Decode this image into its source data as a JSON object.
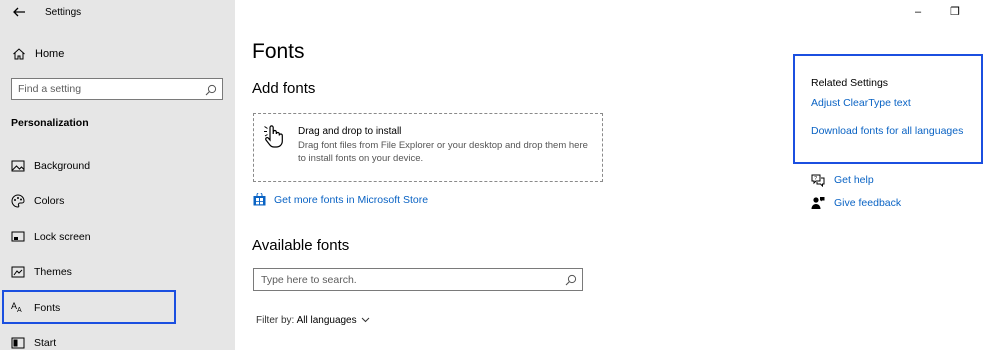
{
  "window": {
    "app_title": "Settings",
    "controls": {
      "minimize": "–",
      "restore": "❐"
    }
  },
  "sidebar": {
    "home_label": "Home",
    "search_placeholder": "Find a setting",
    "section_title": "Personalization",
    "items": [
      {
        "label": "Background",
        "icon": "picture-icon"
      },
      {
        "label": "Colors",
        "icon": "palette-icon"
      },
      {
        "label": "Lock screen",
        "icon": "lock-screen-icon"
      },
      {
        "label": "Themes",
        "icon": "themes-icon"
      },
      {
        "label": "Fonts",
        "icon": "fonts-icon",
        "active": true
      },
      {
        "label": "Start",
        "icon": "start-icon"
      }
    ]
  },
  "main": {
    "title": "Fonts",
    "add_fonts": {
      "heading": "Add fonts",
      "drop_title": "Drag and drop to install",
      "drop_text": "Drag font files from File Explorer or your desktop and drop them here to install fonts on your device.",
      "store_link": "Get more fonts in Microsoft Store"
    },
    "available_fonts": {
      "heading": "Available fonts",
      "search_placeholder": "Type here to search.",
      "filter_label": "Filter by:",
      "filter_value": "All languages"
    }
  },
  "related": {
    "title": "Related Settings",
    "links": [
      "Adjust ClearType text",
      "Download fonts for all languages"
    ],
    "get_help": "Get help",
    "give_feedback": "Give feedback"
  },
  "colors": {
    "link": "#0a63c4",
    "highlight_border": "#1b4fe0",
    "sidebar_bg": "#e6e6e6"
  }
}
